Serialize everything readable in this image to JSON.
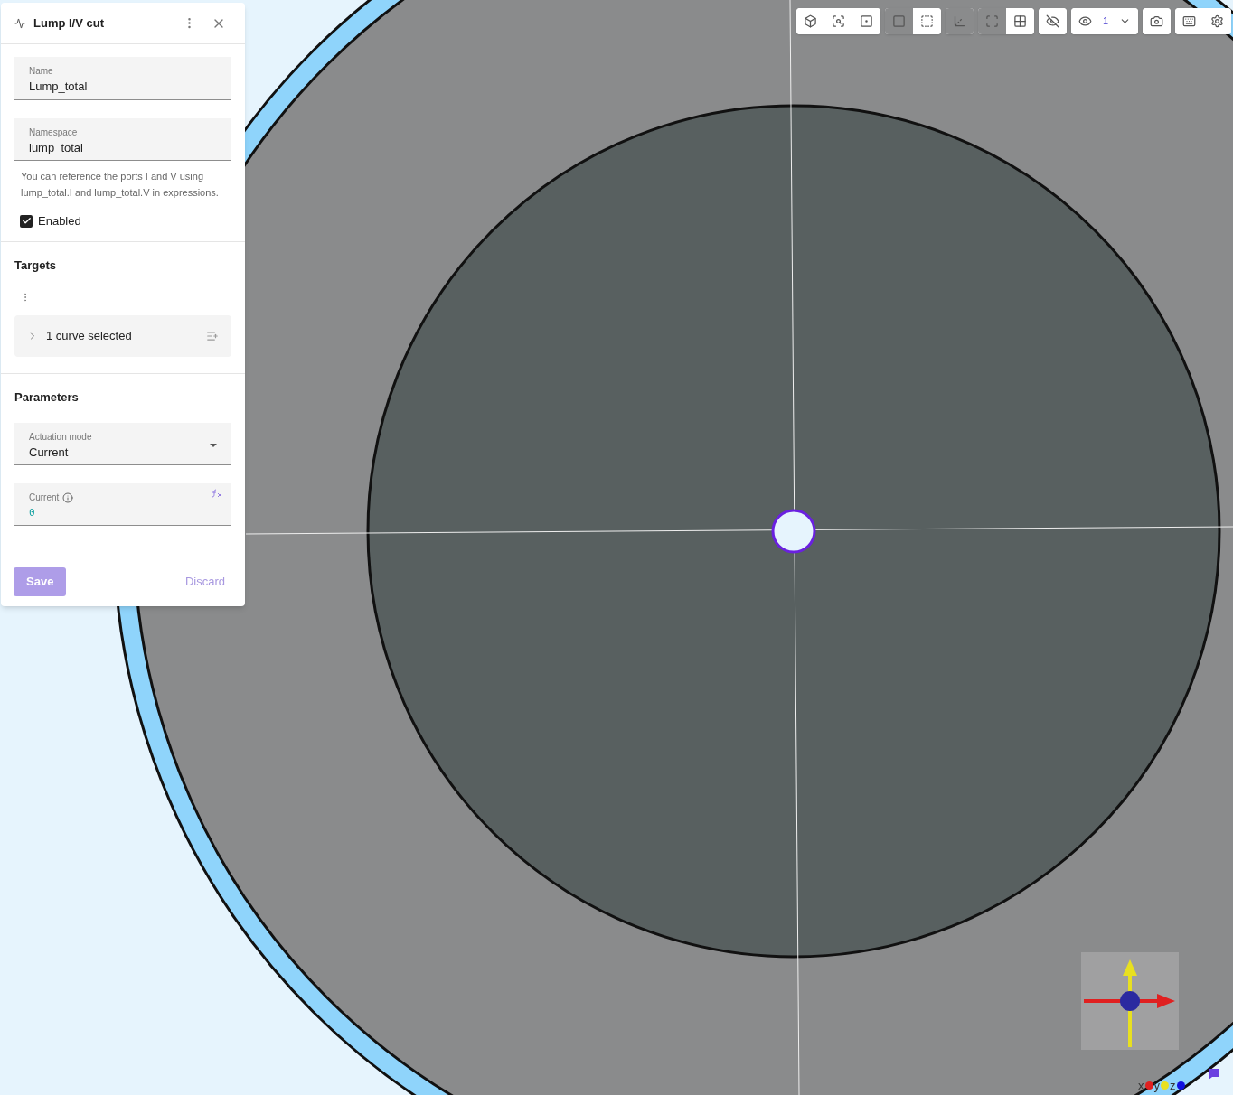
{
  "panel": {
    "title": "Lump I/V cut",
    "fields": [
      {
        "label": "Name",
        "value": "Lump_total"
      },
      {
        "label": "Namespace",
        "value": "lump_total"
      }
    ],
    "help_text": "You can reference the ports I and V using lump_total.I and lump_total.V in expressions.",
    "enabled": {
      "label": "Enabled",
      "checked": true
    },
    "targets": {
      "title": "Targets",
      "selection": {
        "label": "1 curve selected",
        "expanded": false
      }
    },
    "parameters": {
      "title": "Parameters",
      "actuation_mode": {
        "label": "Actuation mode",
        "value": "Current"
      },
      "current": {
        "label": "Current",
        "value": "0"
      }
    },
    "buttons": {
      "save": {
        "label": "Save",
        "disabled": true
      },
      "discard": {
        "label": "Discard",
        "disabled": true
      }
    }
  },
  "toolbar": {
    "groups": [
      {
        "buttons": [
          {
            "kind": "fit-object"
          },
          {
            "kind": "zoom-fit"
          },
          {
            "kind": "frame"
          }
        ]
      },
      {
        "buttons": [
          {
            "kind": "select-box",
            "selected": false
          },
          {
            "kind": "select-dotted",
            "selected": true
          }
        ]
      },
      {
        "buttons": [
          {
            "kind": "axes"
          }
        ]
      },
      {
        "buttons": [
          {
            "kind": "perspective",
            "selected": false
          },
          {
            "kind": "grid",
            "selected": true
          }
        ]
      },
      {
        "buttons": [
          {
            "kind": "visibility"
          }
        ]
      },
      {
        "buttons": [
          {
            "kind": "visibility-count",
            "value": "1"
          }
        ]
      },
      {
        "buttons": [
          {
            "kind": "camera"
          }
        ]
      },
      {
        "buttons": [
          {
            "kind": "keyboard"
          },
          {
            "kind": "settings"
          }
        ]
      }
    ]
  },
  "axis_legend": [
    {
      "label": "x",
      "color": "#e02020"
    },
    {
      "label": "y",
      "color": "#e8e020"
    },
    {
      "label": "z",
      "color": "#1010e0"
    }
  ]
}
